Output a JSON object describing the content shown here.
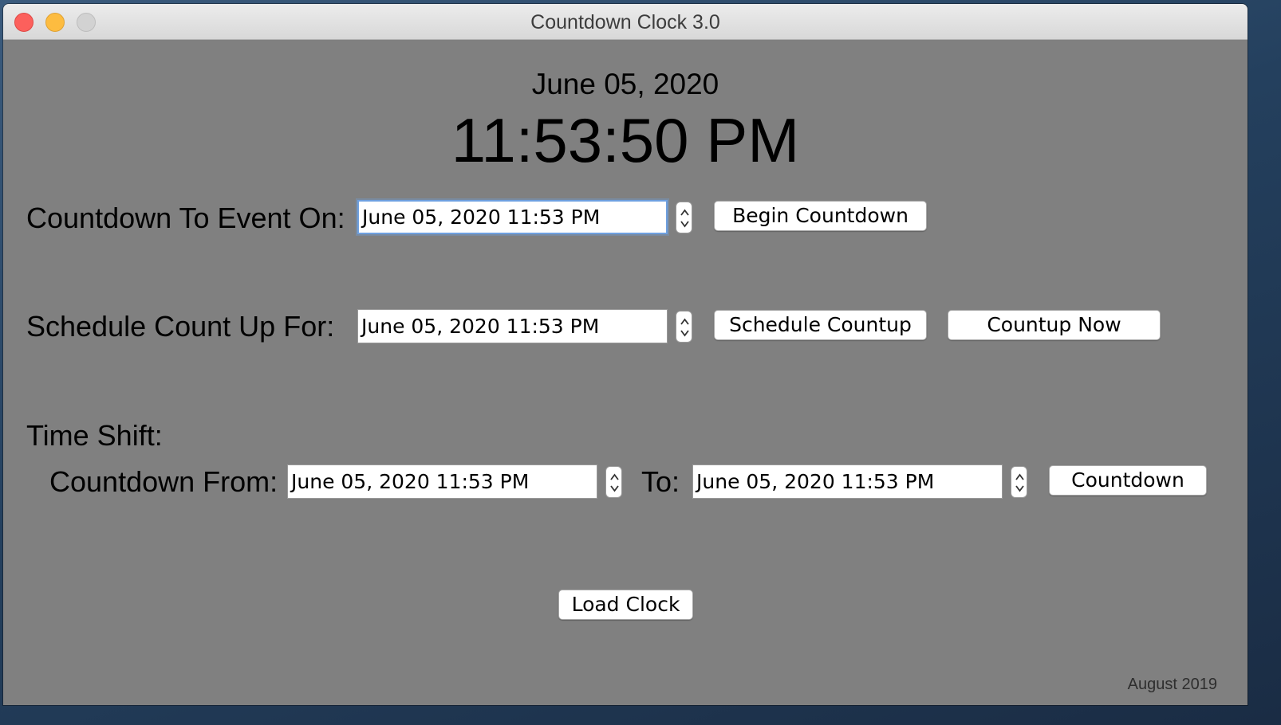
{
  "window": {
    "title": "Countdown Clock 3.0",
    "buttons": {
      "close": "close-icon",
      "minimize": "minimize-icon",
      "zoom": "zoom-icon"
    }
  },
  "clock": {
    "date": "June 05, 2020",
    "time": "11:53:50 PM"
  },
  "countdown_event": {
    "label": "Countdown To Event On:",
    "value": "June 05, 2020  11:53 PM",
    "button": "Begin Countdown"
  },
  "countup": {
    "label": "Schedule Count Up For:",
    "value": "June 05, 2020  11:53 PM",
    "schedule_button": "Schedule Countup",
    "now_button": "Countup Now"
  },
  "time_shift": {
    "label": "Time Shift:",
    "from_label": "Countdown From:",
    "from_value": "June 05, 2020  11:53 PM",
    "to_label": "To:",
    "to_value": "June 05, 2020  11:53 PM",
    "button": "Countdown"
  },
  "load_button": "Load Clock",
  "footer": "August 2019",
  "colors": {
    "window_bg": "#808080",
    "focus_ring": "#6ea0e0",
    "close": "#fc605c",
    "minimize": "#fdbc40",
    "zoom_inactive": "#d2d2d2"
  }
}
